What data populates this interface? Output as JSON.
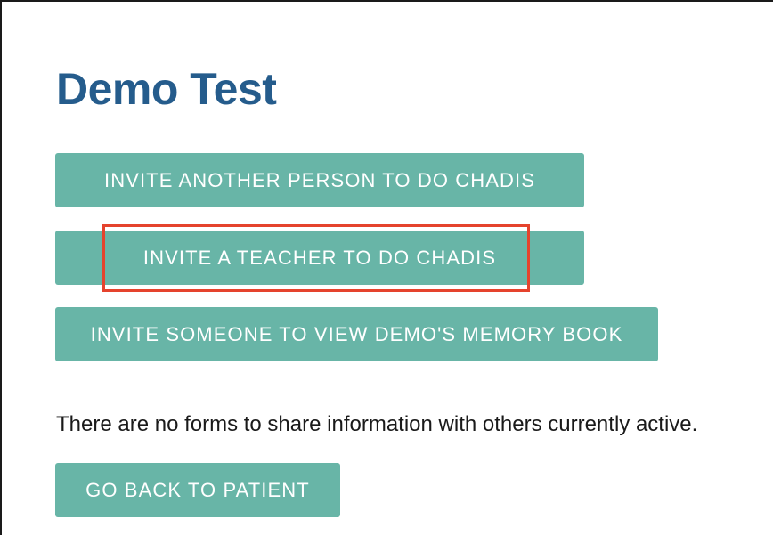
{
  "page": {
    "title": "Demo Test"
  },
  "actions": {
    "invite_person_label": "INVITE ANOTHER PERSON TO DO CHADIS",
    "invite_teacher_label": "INVITE A TEACHER TO DO CHADIS",
    "invite_memory_book_label": "INVITE SOMEONE TO VIEW DEMO'S MEMORY BOOK"
  },
  "status": {
    "message": "There are no forms to share information with others currently active."
  },
  "navigation": {
    "back_label": "GO BACK TO PATIENT"
  },
  "colors": {
    "title": "#255c8c",
    "button_bg": "#68b5a7",
    "highlight": "#e5432d"
  }
}
